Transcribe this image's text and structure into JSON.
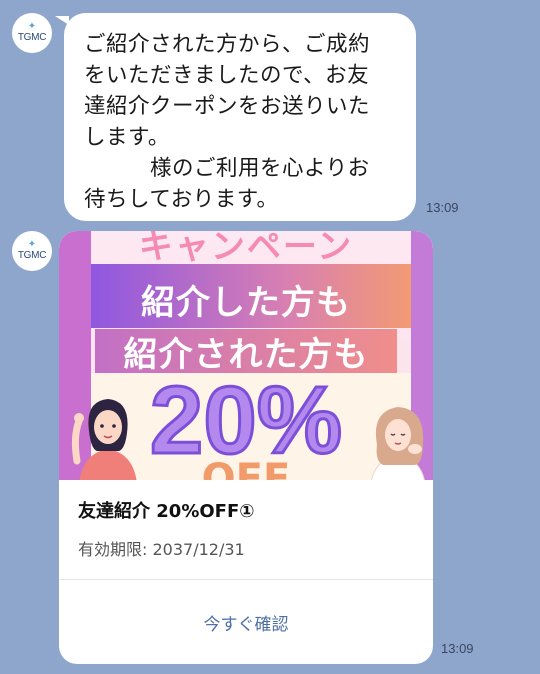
{
  "message1": {
    "avatar_text": "TGMC",
    "text": "ご紹介された方から、ご成約\nをいただきましたので、お友\n達紹介クーポンをお送りいた\nします。\n　　　様のご利用を心よりお\n待ちしております。",
    "time": "13:09"
  },
  "message2": {
    "avatar_text": "TGMC",
    "banner": {
      "top_text": "キャンペーン",
      "line1": "紹介した方も",
      "line2": "紹介された方も",
      "big": "20%",
      "peek": "OFF"
    },
    "title": "友達紹介 20%OFF①",
    "expiry": "有効期限: 2037/12/31",
    "action_label": "今すぐ確認",
    "time": "13:09"
  },
  "colors": {
    "background": "#8fa6cc",
    "bubble": "#ffffff",
    "link": "#4e6fa6"
  },
  "icons": {
    "avatar_mark": "sparkle-icon"
  }
}
